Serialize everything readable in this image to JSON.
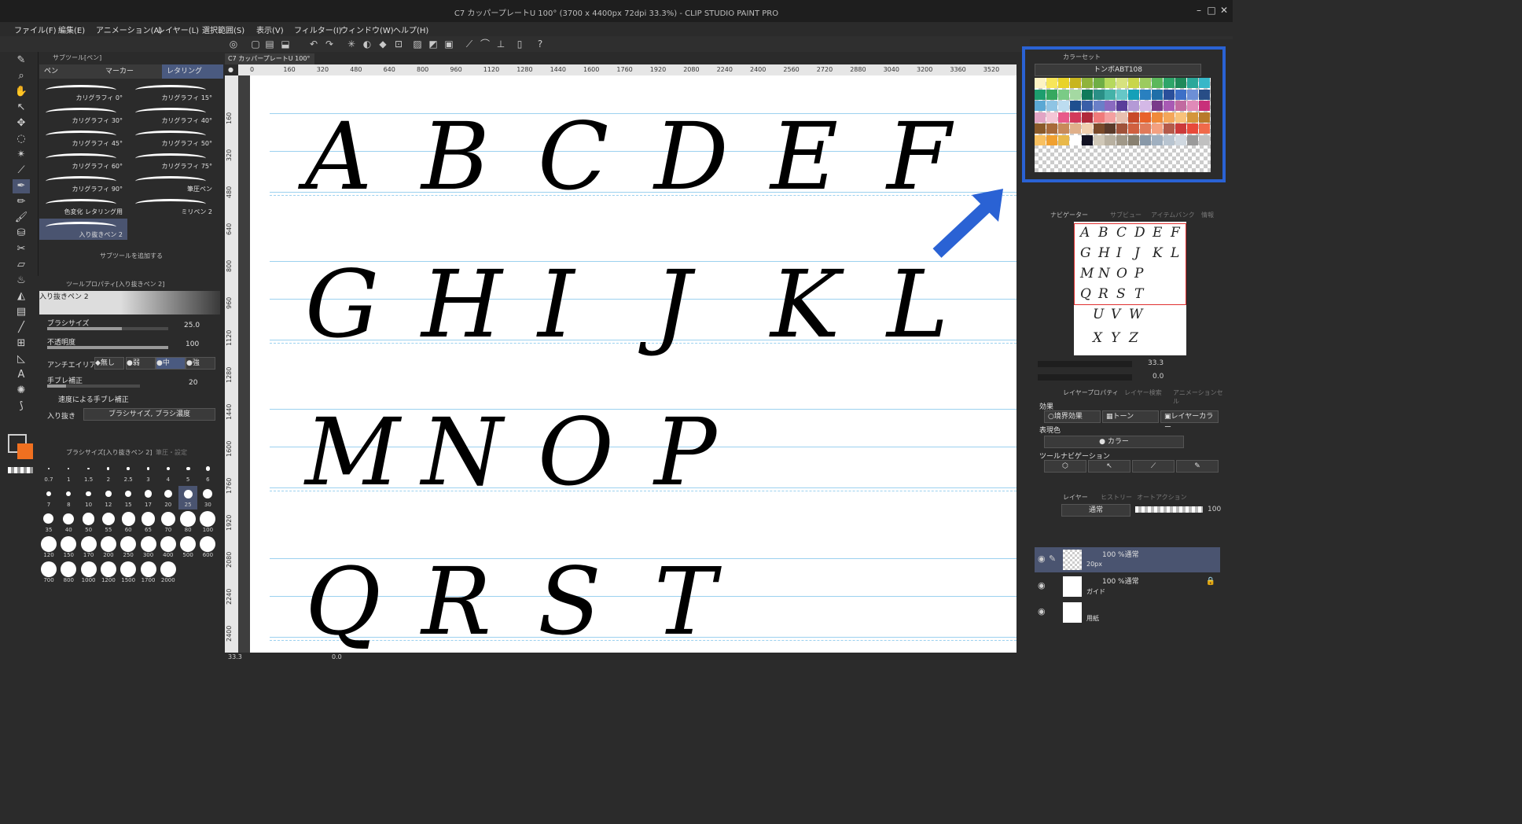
{
  "window": {
    "title": "C7 カッパープレートU 100° (3700 x 4400px 72dpi 33.3%) - CLIP STUDIO PAINT PRO"
  },
  "menu": [
    "ファイル(F)",
    "編集(E)",
    "アニメーション(A)",
    "レイヤー(L)",
    "選択範囲(S)",
    "表示(V)",
    "フィルター(I)",
    "ウィンドウ(W)",
    "ヘルプ(H)"
  ],
  "subtool_panel": {
    "header": "サブツール[ペン]",
    "tabs": [
      "ペン",
      "マーカー",
      "レタリング"
    ],
    "brushes": [
      "カリグラフィ 0°",
      "カリグラフィ 15°",
      "カリグラフィ 30°",
      "カリグラフィ 40°",
      "カリグラフィ 45°",
      "カリグラフィ 50°",
      "カリグラフィ 60°",
      "カリグラフィ 75°",
      "カリグラフィ 90°",
      "筆圧ペン",
      "色変化 レタリング用",
      "ミリペン 2",
      "入り抜きペン 2"
    ],
    "add_subtool": "サブツールを追加する"
  },
  "tool_property": {
    "header": "ツールプロパティ[入り抜きペン 2]",
    "preset_name": "入り抜きペン 2",
    "brush_size_label": "ブラシサイズ",
    "brush_size_value": "25.0",
    "opacity_label": "不透明度",
    "opacity_value": "100",
    "antialias_label": "アンチエイリアス",
    "antialias_options": [
      "無し",
      "弱",
      "中",
      "強"
    ],
    "stabilization_label": "手ブレ補正",
    "stabilization_value": "20",
    "speed_stabilization": "速度による手ブレ補正",
    "taper_label": "入り抜き",
    "taper_value": "ブラシサイズ, ブラシ濃度"
  },
  "brush_size_panel": {
    "header": "ブラシサイズ[入り抜きペン 2]",
    "header2": "筆圧・設定",
    "sizes": [
      "0.7",
      "1",
      "1.5",
      "2",
      "2.5",
      "3",
      "4",
      "5",
      "6",
      "7",
      "8",
      "10",
      "12",
      "15",
      "17",
      "20",
      "25",
      "30",
      "35",
      "40",
      "50",
      "55",
      "60",
      "65",
      "70",
      "80",
      "100",
      "120",
      "150",
      "170",
      "200",
      "250",
      "300",
      "400",
      "500",
      "600",
      "700",
      "800",
      "1000",
      "1200",
      "1500",
      "1700",
      "2000"
    ],
    "selected": "25"
  },
  "canvas": {
    "tab_label": "C7 カッパープレートU 100°",
    "ruler_top": [
      "0",
      "160",
      "320",
      "480",
      "640",
      "800",
      "960",
      "1120",
      "1280",
      "1440",
      "1600",
      "1760",
      "1920",
      "2080",
      "2240",
      "2400",
      "2560",
      "2720",
      "2880",
      "3040",
      "3200",
      "3360",
      "3520"
    ],
    "ruler_left": [
      "160",
      "320",
      "480",
      "640",
      "800",
      "960",
      "1120",
      "1280",
      "1440",
      "1600",
      "1760",
      "1920",
      "2080",
      "2240",
      "2400"
    ],
    "rows": [
      [
        "A",
        "B",
        "C",
        "D",
        "E",
        "F"
      ],
      [
        "G",
        "H",
        "I",
        "J",
        "K",
        "L"
      ],
      [
        "M",
        "N",
        "O",
        "P"
      ],
      [
        "Q",
        "R",
        "S",
        "T"
      ]
    ],
    "zoom": "33.3",
    "rotate": "0.0"
  },
  "color_set": {
    "header": "カラーセット",
    "set_name": "トンボABT108",
    "swatches": [
      "#fdf3c4",
      "#f7e65a",
      "#e8d32a",
      "#c8b51f",
      "#8fb33c",
      "#6fae45",
      "#b6d95d",
      "#d7e27f",
      "#c9d64a",
      "#9ccb5e",
      "#5cb85c",
      "#2ea56a",
      "#1f8a5a",
      "#2aa89a",
      "#37b7c8",
      "#1d9e6e",
      "#36a85f",
      "#7acb86",
      "#a4d9a2",
      "#0f7a5a",
      "#2a8f86",
      "#44b2a8",
      "#66c7c7",
      "#14a0b8",
      "#2980c0",
      "#1f6fa8",
      "#2a4f9b",
      "#3d6fc7",
      "#6d8fd6",
      "#284d86",
      "#5aa8d4",
      "#8ec4e4",
      "#bcdcf0",
      "#1f4f8f",
      "#3a5ea8",
      "#6a7fc8",
      "#8a6ac0",
      "#5a3e9a",
      "#b49ad6",
      "#d4b8e6",
      "#7a3a8a",
      "#a85ab4",
      "#c26aa0",
      "#e08ab8",
      "#c8307a",
      "#e2a4c4",
      "#f4c6d6",
      "#e85a8a",
      "#d23a5a",
      "#b02a3a",
      "#f07a7a",
      "#f4a0a0",
      "#e8c0b0",
      "#c84a2a",
      "#e8622a",
      "#f08a3a",
      "#f4a65a",
      "#f8c27a",
      "#d4963a",
      "#b87a2a",
      "#8a5a2a",
      "#a86a3a",
      "#c88a5a",
      "#e0b08a",
      "#f0d0b0",
      "#7a4a2a",
      "#5a3a2a",
      "#a0523a",
      "#d06040",
      "#e07a5a",
      "#f4a080",
      "#b45a4a",
      "#cc3a3a",
      "#e84a3a",
      "#f06a4a",
      "#f8c060",
      "#f0a030",
      "#e8b84a",
      "#ffffff",
      "#111122",
      "#d0c8b8",
      "#b8b0a0",
      "#a09888",
      "#888070",
      "#8898a8",
      "#a0b0c0",
      "#b8c4d0",
      "#d0d8e0",
      "#9a9a9a",
      "#c0c0c0"
    ]
  },
  "navigator": {
    "tabs": [
      "ナビゲーター",
      "サブビュー",
      "アイテムバンク",
      "情報"
    ],
    "rows": [
      [
        "A",
        "B",
        "C",
        "D",
        "E",
        "F"
      ],
      [
        "G",
        "H",
        "I",
        "J",
        "K",
        "L"
      ],
      [
        "M",
        "N",
        "O",
        "P"
      ],
      [
        "Q",
        "R",
        "S",
        "T"
      ],
      [
        "U",
        "V",
        "W"
      ],
      [
        "X",
        "Y",
        "Z"
      ]
    ],
    "zoom_value": "33.3",
    "rotate_value": "0.0"
  },
  "layer_property": {
    "tabs": [
      "レイヤープロパティ",
      "レイヤー検索",
      "アニメーションセル"
    ],
    "effect_label": "効果",
    "effects": [
      "境界効果",
      "トーン",
      "レイヤーカラー"
    ],
    "expression_color_label": "表現色",
    "expression_color_value": "カラー",
    "tool_nav_label": "ツールナビゲーション"
  },
  "layers": {
    "tabs": [
      "レイヤー",
      "ヒストリー",
      "オートアクション"
    ],
    "blend_mode": "通常",
    "opacity": "100",
    "items": [
      {
        "name": "100 %通常",
        "sub": "20px"
      },
      {
        "name": "100 %通常",
        "sub": "ガイド"
      },
      {
        "name": "",
        "sub": "用紙"
      }
    ]
  },
  "status": {
    "zoom": "33.3",
    "angle": "0.0"
  },
  "colors": {
    "highlight_border": "#2a62d4",
    "arrow": "#2a62d4",
    "guide_line": "#9cd1ef",
    "main_color": "#2a2a2a",
    "sub_color": "#f07020"
  }
}
